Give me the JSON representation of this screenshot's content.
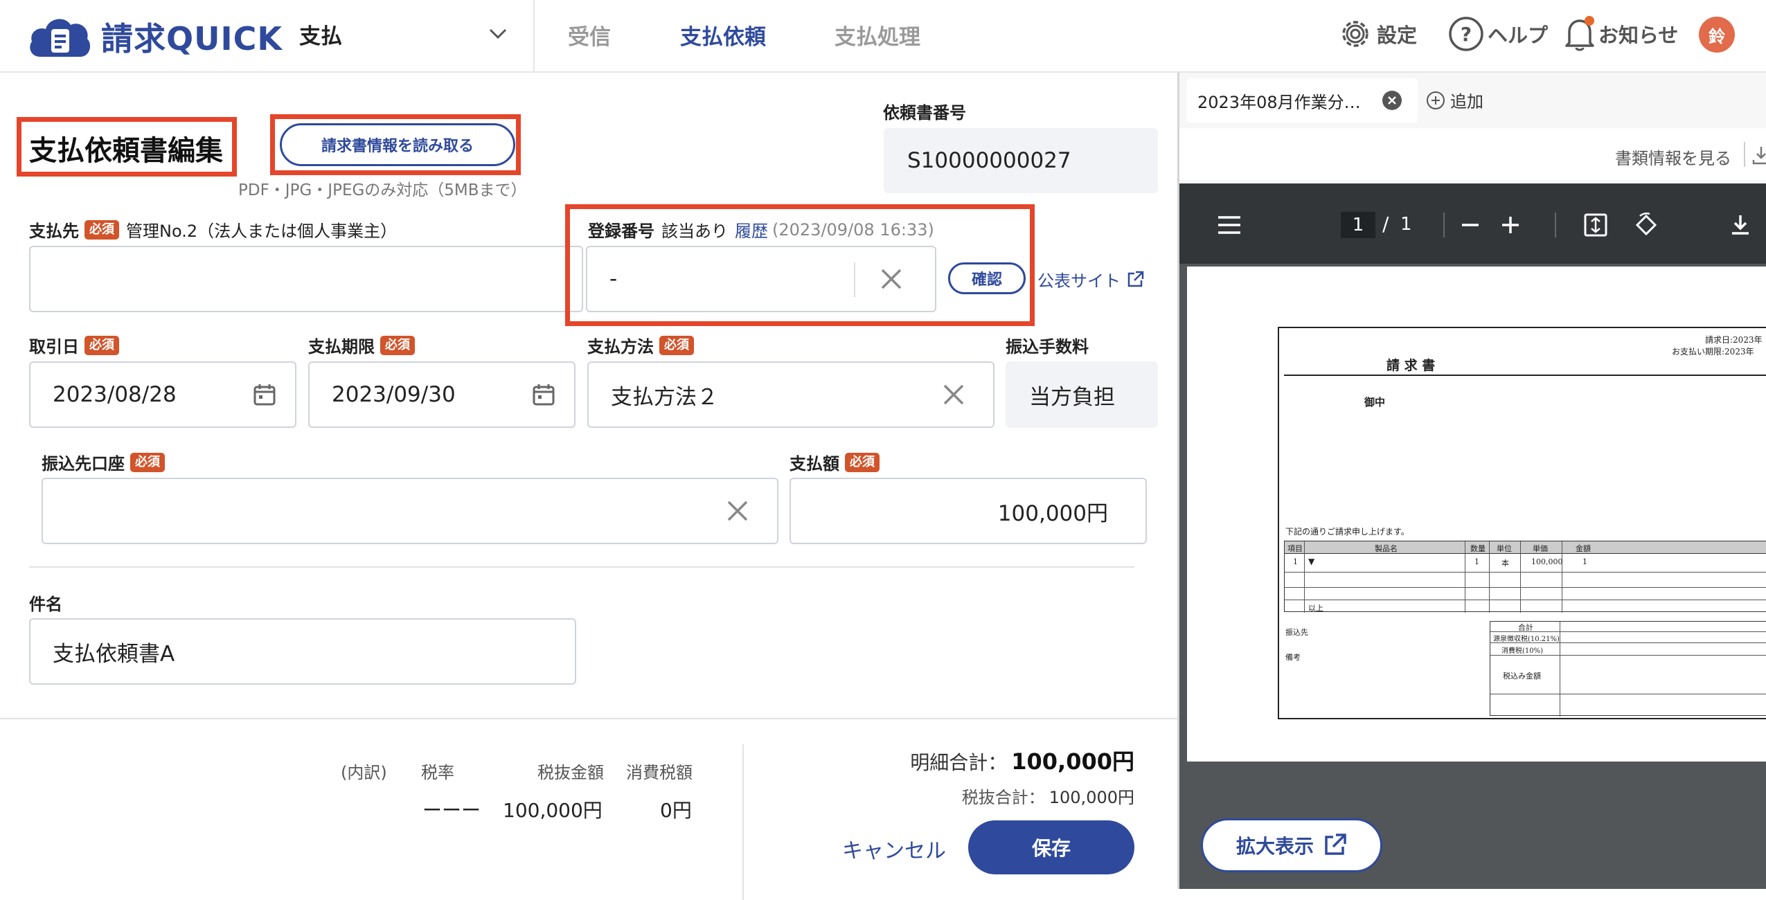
{
  "header": {
    "logo_text": "請求QUICK",
    "module_select": "支払",
    "tabs": [
      {
        "label": "受信",
        "active": false
      },
      {
        "label": "支払依頼",
        "active": true
      },
      {
        "label": "支払処理",
        "active": false
      }
    ],
    "settings_label": "設定",
    "help_label": "ヘルプ",
    "notifications_label": "お知らせ",
    "avatar_text": "鈴"
  },
  "form": {
    "page_title": "支払依頼書編集",
    "read_invoice_button": "請求書情報を読み取る",
    "file_note": "PDF・JPG・JPEGのみ対応（5MBまで）",
    "request_number_label": "依頼書番号",
    "request_number": "S10000000027",
    "payee": {
      "label": "支払先",
      "required": "必須",
      "note": "管理No.2（法人または個人事業主）",
      "value": ""
    },
    "registration": {
      "label": "登録番号",
      "status": "該当あり",
      "history_link": "履歴",
      "history_time": "(2023/09/08 16:33)",
      "value": "-",
      "confirm_button": "確認",
      "public_site_link": "公表サイト"
    },
    "transaction_date": {
      "label": "取引日",
      "required": "必須",
      "value": "2023/08/28"
    },
    "payment_due": {
      "label": "支払期限",
      "required": "必須",
      "value": "2023/09/30"
    },
    "payment_method": {
      "label": "支払方法",
      "required": "必須",
      "value": "支払方法２"
    },
    "transfer_fee": {
      "label": "振込手数料",
      "value": "当方負担"
    },
    "bank_account": {
      "label": "振込先口座",
      "required": "必須",
      "value": ""
    },
    "amount": {
      "label": "支払額",
      "required": "必須",
      "value": "100,000円"
    },
    "subject": {
      "label": "件名",
      "value": "支払依頼書A"
    }
  },
  "summary": {
    "breakdown_label": "(内訳)",
    "col_rate": "税率",
    "col_pretax": "税抜金額",
    "col_tax": "消費税額",
    "row_rate": "ーーー",
    "row_pretax": "100,000円",
    "row_tax": "0円",
    "detail_total_label": "明細合計：",
    "detail_total": "100,000円",
    "pretax_total_label": "税抜合計：",
    "pretax_total": "100,000円",
    "cancel_button": "キャンセル",
    "save_button": "保存"
  },
  "viewer": {
    "file_tab": "2023年08月作業分…",
    "add_label": "追加",
    "doc_info_link": "書類情報を見る",
    "page_current": "1",
    "page_separator": "/",
    "page_total": "1",
    "expand_button": "拡大表示",
    "doc": {
      "issue_date": "請求日:2023年",
      "due_date": "お支払い期限:2023年",
      "title": "請 求 書",
      "recipient": "御中",
      "intro": "下記の通りご請求申し上げます。",
      "cols": [
        "項目",
        "製品名",
        "数量",
        "単位",
        "単価",
        "金額"
      ],
      "row1": [
        "1",
        "▼",
        "1",
        "本",
        "100,000",
        "1"
      ],
      "end_mark": "以上",
      "bank_label": "振込先",
      "notes_label": "備考",
      "total_label": "合計",
      "withholding_label": "源泉徴収税(10.21%)",
      "tax_label": "消費税(10%)",
      "grand_label": "税込み金額"
    }
  },
  "colors": {
    "brand": "#2f4a9c",
    "required": "#d2542a",
    "highlight": "#e5452a"
  }
}
